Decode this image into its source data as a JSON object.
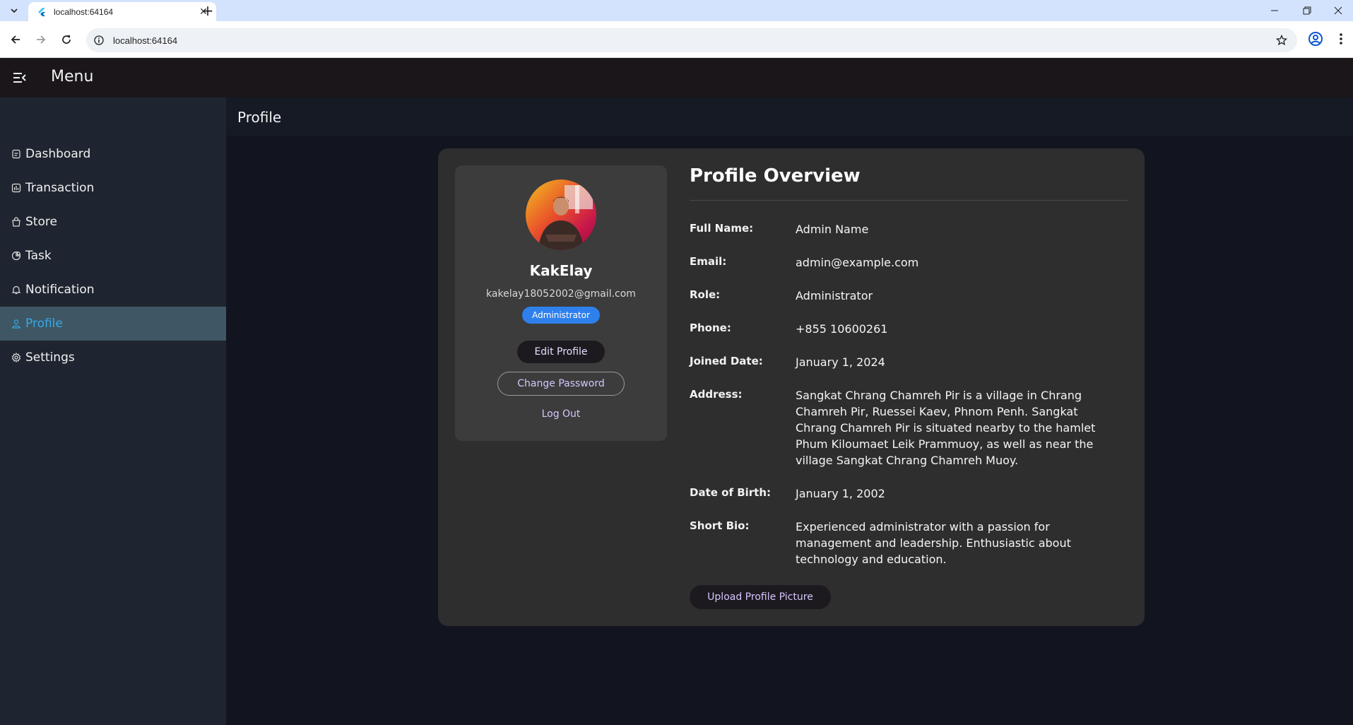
{
  "browser": {
    "tab_title": "localhost:64164",
    "url": "localhost:64164"
  },
  "app": {
    "menu_title": "Menu",
    "page_title": "Profile"
  },
  "sidebar": {
    "items": [
      {
        "label": "Dashboard",
        "icon": "dashboard-icon"
      },
      {
        "label": "Transaction",
        "icon": "chart-icon"
      },
      {
        "label": "Store",
        "icon": "store-bag-icon"
      },
      {
        "label": "Task",
        "icon": "task-icon"
      },
      {
        "label": "Notification",
        "icon": "bell-icon"
      },
      {
        "label": "Profile",
        "icon": "person-icon",
        "active": true
      },
      {
        "label": "Settings",
        "icon": "gear-icon"
      }
    ]
  },
  "profile_card": {
    "name": "KakElay",
    "email": "kakelay18052002@gmail.com",
    "role_badge": "Administrator",
    "edit_label": "Edit Profile",
    "change_password_label": "Change Password",
    "logout_label": "Log Out"
  },
  "overview": {
    "title": "Profile Overview",
    "fields": [
      {
        "label": "Full Name:",
        "value": "Admin Name"
      },
      {
        "label": "Email:",
        "value": "admin@example.com"
      },
      {
        "label": "Role:",
        "value": "Administrator"
      },
      {
        "label": "Phone:",
        "value": "+855 10600261"
      },
      {
        "label": "Joined Date:",
        "value": "January 1, 2024"
      },
      {
        "label": "Address:",
        "value": "Sangkat Chrang Chamreh Pir is a village in Chrang Chamreh Pir, Ruessei Kaev, Phnom Penh. Sangkat Chrang Chamreh Pir is situated nearby to the hamlet Phum Kiloumaet Leik Prammuoy, as well as near the village Sangkat Chrang Chamreh Muoy."
      },
      {
        "label": "Date of Birth:",
        "value": "January 1, 2002"
      },
      {
        "label": "Short Bio:",
        "value": "Experienced administrator with a passion for management and leadership. Enthusiastic about technology and education."
      }
    ],
    "upload_label": "Upload Profile Picture"
  },
  "colors": {
    "active_nav_bg": "#3f5764",
    "active_nav_text": "#35a9e6",
    "badge": "#2f80ed",
    "button_text": "#d6c6ff"
  }
}
